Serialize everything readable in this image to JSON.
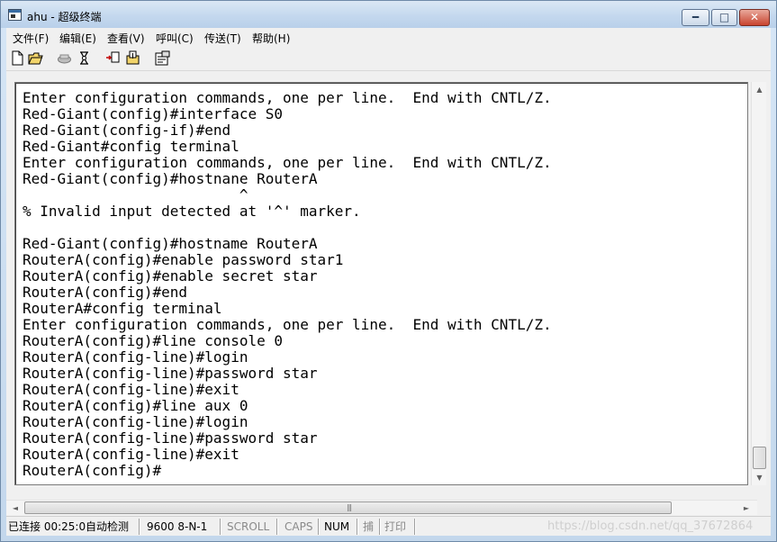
{
  "window": {
    "title": "ahu - 超级终端"
  },
  "title_buttons": {
    "minimize": "━",
    "maximize": "□",
    "close": "✕"
  },
  "menu": [
    "文件(F)",
    "编辑(E)",
    "查看(V)",
    "呼叫(C)",
    "传送(T)",
    "帮助(H)"
  ],
  "toolbar": {
    "icons": [
      "new-connection-icon",
      "open-folder-icon",
      "call-icon",
      "disconnect-icon",
      "send-file-icon",
      "receive-file-icon",
      "properties-icon"
    ]
  },
  "terminal": {
    "lines": [
      "Enter configuration commands, one per line.  End with CNTL/Z.",
      "Red-Giant(config)#interface S0",
      "Red-Giant(config-if)#end",
      "Red-Giant#config terminal",
      "Enter configuration commands, one per line.  End with CNTL/Z.",
      "Red-Giant(config)#hostnane RouterA",
      "                         ^",
      "% Invalid input detected at '^' marker.",
      "",
      "Red-Giant(config)#hostname RouterA",
      "RouterA(config)#enable password star1",
      "RouterA(config)#enable secret star",
      "RouterA(config)#end",
      "RouterA#config terminal",
      "Enter configuration commands, one per line.  End with CNTL/Z.",
      "RouterA(config)#line console 0",
      "RouterA(config-line)#login",
      "RouterA(config-line)#password star",
      "RouterA(config-line)#exit",
      "RouterA(config)#line aux 0",
      "RouterA(config-line)#login",
      "RouterA(config-line)#password star",
      "RouterA(config-line)#exit",
      "RouterA(config)#"
    ]
  },
  "scrollbars": {
    "up": "▲",
    "down": "▼",
    "left": "◄",
    "right": "►",
    "grip": "|||"
  },
  "status": {
    "connection": "已连接 00:25:0",
    "detect": "自动检测",
    "baud": "9600 8-N-1",
    "scroll": "SCROLL",
    "caps": "CAPS",
    "num": "NUM",
    "capture": "捕",
    "print": "打印"
  },
  "watermark": "https://blog.csdn.net/qq_37672864"
}
